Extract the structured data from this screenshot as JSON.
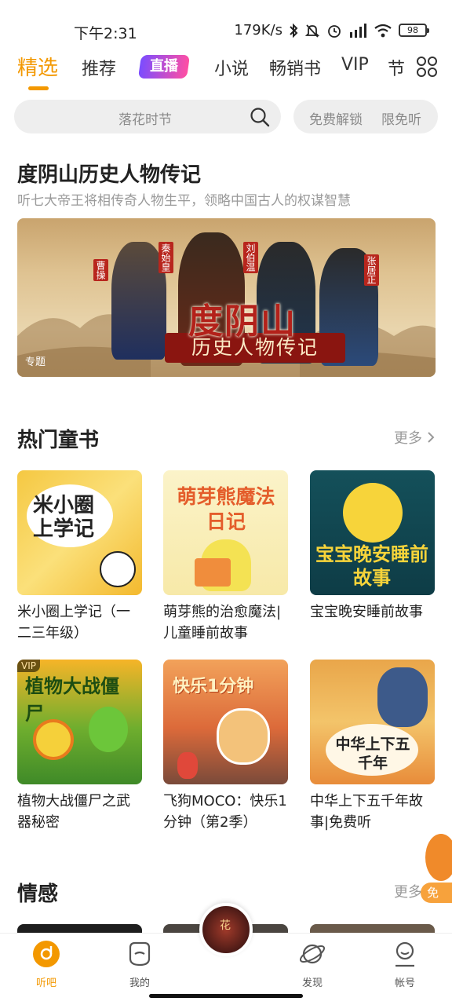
{
  "status_bar": {
    "time": "下午2:31",
    "network_speed": "179K/s",
    "battery": "98"
  },
  "tabs": [
    {
      "label": "精选",
      "active": true
    },
    {
      "label": "推荐"
    },
    {
      "label": "直播"
    },
    {
      "label": "小说"
    },
    {
      "label": "畅销书"
    },
    {
      "label": "VIP"
    },
    {
      "label": "节"
    }
  ],
  "search": {
    "placeholder": "落花时节",
    "pill_left": "免费解锁",
    "pill_right": "限免听"
  },
  "feature": {
    "title": "度阴山历史人物传记",
    "subtitle": "听七大帝王将相传奇人物生平，领略中国古人的权谋智慧",
    "banner_tag": "专题",
    "banner_title": "度阴山",
    "banner_subtitle": "历史人物传记",
    "banner_names": [
      "曹操",
      "秦始皇",
      "刘伯温",
      "张居正"
    ]
  },
  "hot_children": {
    "title": "热门童书",
    "more": "更多",
    "books": [
      {
        "title": "米小圈上学记（一二三年级）",
        "cover_text": "米小圈上学记",
        "vip": false
      },
      {
        "title": "萌芽熊的治愈魔法|儿童睡前故事",
        "cover_text": "萌芽熊魔法日记",
        "vip": false
      },
      {
        "title": "宝宝晚安睡前故事",
        "cover_text": "宝宝晚安睡前故事",
        "vip": false
      },
      {
        "title": "植物大战僵尸之武器秘密",
        "cover_text": "植物大战僵尸",
        "vip": true
      },
      {
        "title": "飞狗MOCO：快乐1分钟（第2季）",
        "cover_text": "快乐1分钟",
        "vip": false
      },
      {
        "title": "中华上下五千年故事|免费听",
        "cover_text": "中华上下五千年",
        "vip": false
      }
    ],
    "vip_label": "VIP"
  },
  "emotion": {
    "title": "情感",
    "more": "更多"
  },
  "floating_badge": "免",
  "bottom_nav": [
    {
      "label": "听吧",
      "icon": "listen-icon",
      "active": true
    },
    {
      "label": "我的",
      "icon": "mine-icon"
    },
    {
      "label": "发现",
      "icon": "planet-icon"
    },
    {
      "label": "帐号",
      "icon": "account-icon"
    }
  ],
  "center_disc_text": "花",
  "colors": {
    "accent": "#f39800",
    "banner_red": "#b3211a"
  }
}
